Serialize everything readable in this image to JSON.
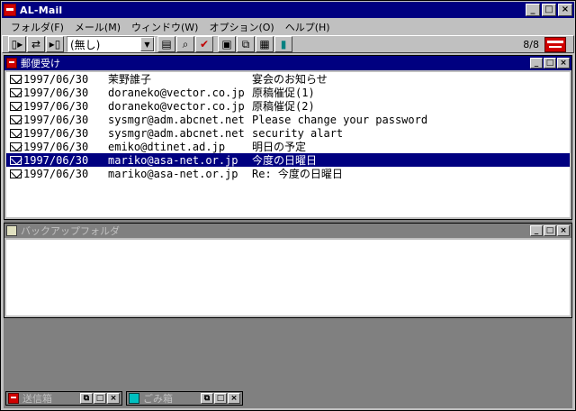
{
  "app": {
    "title": "AL-Mail"
  },
  "menu": [
    "フォルダ(F)",
    "メール(M)",
    "ウィンドウ(W)",
    "オプション(O)",
    "ヘルプ(H)"
  ],
  "toolbar": {
    "folder_select": "(無し)",
    "counter": "8/8"
  },
  "inbox": {
    "title": "郵便受け",
    "selected_index": 6,
    "mails": [
      {
        "date": "1997/06/30",
        "from": "茉野誰子",
        "subject": "宴会のお知らせ"
      },
      {
        "date": "1997/06/30",
        "from": "doraneko@vector.co.jp",
        "subject": "原稿催促(1)"
      },
      {
        "date": "1997/06/30",
        "from": "doraneko@vector.co.jp",
        "subject": "原稿催促(2)"
      },
      {
        "date": "1997/06/30",
        "from": "sysmgr@adm.abcnet.net",
        "subject": "Please change your password"
      },
      {
        "date": "1997/06/30",
        "from": "sysmgr@adm.abcnet.net",
        "subject": "security alart"
      },
      {
        "date": "1997/06/30",
        "from": "emiko@dtinet.ad.jp",
        "subject": "明日の予定"
      },
      {
        "date": "1997/06/30",
        "from": "mariko@asa-net.or.jp",
        "subject": "今度の日曜日"
      },
      {
        "date": "1997/06/30",
        "from": "mariko@asa-net.or.jp",
        "subject": "Re: 今度の日曜日"
      }
    ]
  },
  "backup": {
    "title": "バックアップフォルダ"
  },
  "minimized": [
    {
      "title": "送信箱"
    },
    {
      "title": "ごみ箱"
    }
  ]
}
